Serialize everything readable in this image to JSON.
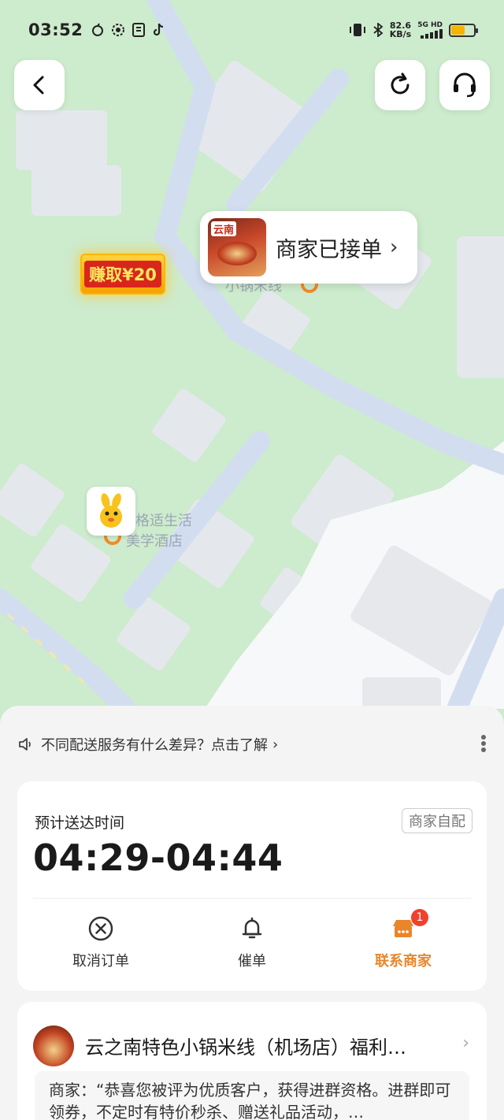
{
  "status_bar": {
    "time": "03:52",
    "left_icons": [
      "netease-icon",
      "settings-gear-icon",
      "note-icon",
      "tiktok-icon"
    ],
    "net_speed_value": "82.6",
    "net_speed_unit": "KB/s",
    "network": "5G HD",
    "battery_level": 0.6
  },
  "map": {
    "poi_noodle": "小锅米线",
    "poi_hotel_line1": "格适生活",
    "poi_hotel_line2": "美学酒店"
  },
  "merchant_bubble": {
    "thumb_title": "云南",
    "status": "商家已接单",
    "chevron": "›"
  },
  "earn_badge": {
    "text": "赚取¥20"
  },
  "tip": {
    "text": "不同配送服务有什么差异？点击了解",
    "chevron": "›"
  },
  "delivery_card": {
    "eta_label": "预计送达时间",
    "eta_value": "04:29-04:44",
    "tag": "商家自配",
    "actions": [
      {
        "label": "取消订单",
        "icon": "cancel-x-circle-icon"
      },
      {
        "label": "催单",
        "icon": "bell-icon"
      },
      {
        "label": "联系商家",
        "icon": "chat-store-icon",
        "badge": "1"
      }
    ]
  },
  "shop_card": {
    "name": "云之南特色小锅米线（机场店）福利…",
    "chevron": "›",
    "message": "商家：“恭喜您被评为优质客户，获得进群资格。进群即可领券，不定时有特价秒杀、赠送礼品活动，…"
  },
  "colors": {
    "accent_orange": "#e9862a",
    "map_green": "#cdebcd",
    "road": "#d2def0",
    "badge_red": "#f0412f"
  }
}
